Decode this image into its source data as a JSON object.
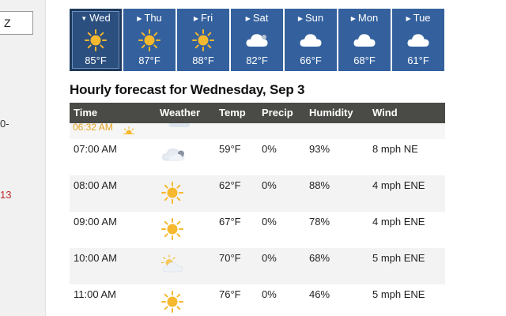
{
  "sidebar": {
    "input_value": "Z",
    "fragment1": "0-",
    "fragment2": "13"
  },
  "days": [
    {
      "name": "Wed",
      "temp": "85°F",
      "icon": "sun-icon",
      "selected": true
    },
    {
      "name": "Thu",
      "temp": "87°F",
      "icon": "sun-icon"
    },
    {
      "name": "Fri",
      "temp": "88°F",
      "icon": "sun-icon"
    },
    {
      "name": "Sat",
      "temp": "82°F",
      "icon": "cloud-icon"
    },
    {
      "name": "Sun",
      "temp": "66°F",
      "icon": "cloud-icon"
    },
    {
      "name": "Mon",
      "temp": "68°F",
      "icon": "cloud-icon"
    },
    {
      "name": "Tue",
      "temp": "61°F",
      "icon": "cloud-icon"
    }
  ],
  "hourly": {
    "title": "Hourly forecast for Wednesday, Sep 3",
    "columns": {
      "time": "Time",
      "weather": "Weather",
      "temp": "Temp",
      "precip": "Precip",
      "humidity": "Humidity",
      "wind": "Wind"
    },
    "sunrise": "06:32 AM",
    "rows": [
      {
        "time": "07:00 AM",
        "icon": "cloud-icon",
        "temp": "59°F",
        "precip": "0%",
        "humidity": "93%",
        "wind": "8 mph NE"
      },
      {
        "time": "08:00 AM",
        "icon": "sun-icon",
        "temp": "62°F",
        "precip": "0%",
        "humidity": "88%",
        "wind": "4 mph ENE"
      },
      {
        "time": "09:00 AM",
        "icon": "sun-icon",
        "temp": "67°F",
        "precip": "0%",
        "humidity": "78%",
        "wind": "4 mph ENE"
      },
      {
        "time": "10:00 AM",
        "icon": "partly-cloudy-icon",
        "temp": "70°F",
        "precip": "0%",
        "humidity": "68%",
        "wind": "5 mph ENE"
      },
      {
        "time": "11:00 AM",
        "icon": "sun-icon",
        "temp": "76°F",
        "precip": "0%",
        "humidity": "46%",
        "wind": "5 mph ENE"
      }
    ]
  },
  "colors": {
    "day_tab": "#34619d",
    "day_tab_selected": "#2b4f7f",
    "table_header": "#4a4a46",
    "sun": "#f5b82e",
    "sunrise_text": "#e6a020"
  }
}
